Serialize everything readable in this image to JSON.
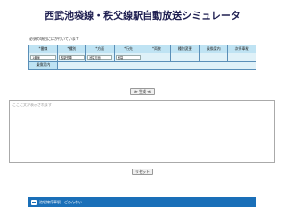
{
  "title": "西武池袋線・秩父線駅自動放送シミュレータ",
  "note": "必須の項目にはが付いています",
  "form": {
    "headers": [
      "*番線",
      "*種別",
      "*方面",
      "*行先",
      "*両数",
      "種別変更",
      "乗換案内",
      "次停車駅"
    ],
    "row2_labels": {
      "track": "1番線",
      "type": "各駅停車",
      "direction": "池袋方面",
      "destination": "池袋"
    },
    "row3_label": "乗換案内"
  },
  "buttons": {
    "generate": "≫ 生成 ≪",
    "reset": "リセット"
  },
  "output": {
    "placeholder": "ここに文が表示されます"
  },
  "footer": {
    "text": "池袋線停車駅　ごあんない"
  }
}
